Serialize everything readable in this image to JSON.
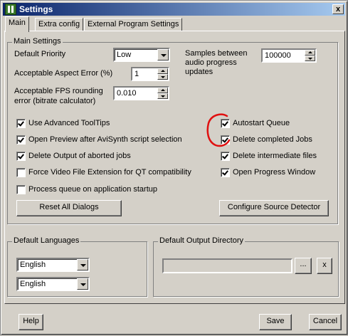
{
  "window": {
    "title": "Settings",
    "close_glyph": "x"
  },
  "tabs": [
    {
      "label": "Main",
      "active": true
    },
    {
      "label": "Extra config",
      "active": false
    },
    {
      "label": "External Program Settings",
      "active": false
    }
  ],
  "main_settings": {
    "group_label": "Main Settings",
    "default_priority_label": "Default Priority",
    "default_priority_value": "Low",
    "aspect_error_label": "Acceptable Aspect Error (%)",
    "aspect_error_value": "1",
    "fps_rounding_label_line1": "Acceptable FPS rounding",
    "fps_rounding_label_line2": "error (bitrate calculator)",
    "fps_rounding_value": "0.010",
    "samples_label_line1": "Samples between",
    "samples_label_line2": "audio progress",
    "samples_label_line3": "updates",
    "samples_value": "100000"
  },
  "checkboxes_left": [
    {
      "label": "Use Advanced ToolTips",
      "checked": true
    },
    {
      "label": "Open Preview after AviSynth script selection",
      "checked": true
    },
    {
      "label": "Delete Output of aborted jobs",
      "checked": true
    },
    {
      "label": "Force Video File Extension for QT compatibility",
      "checked": false
    },
    {
      "label": "Process queue on application startup",
      "checked": false
    }
  ],
  "checkboxes_right": [
    {
      "label": "Autostart Queue",
      "checked": true
    },
    {
      "label": "Delete completed Jobs",
      "checked": true
    },
    {
      "label": "Delete intermediate files",
      "checked": true
    },
    {
      "label": "Open Progress Window",
      "checked": true
    }
  ],
  "buttons": {
    "reset_all_dialogs": "Reset All Dialogs",
    "configure_source_detector": "Configure Source Detector",
    "browse": "...",
    "clear": "x",
    "help": "Help",
    "save": "Save",
    "cancel": "Cancel"
  },
  "default_languages": {
    "group_label": "Default Languages",
    "language1": "English",
    "language2": "English"
  },
  "default_output_directory": {
    "group_label": "Default Output Directory",
    "value": ""
  },
  "colors": {
    "annotation_red": "#e01010",
    "title_gradient_start": "#0a246a",
    "title_gradient_end": "#a6caf0"
  }
}
